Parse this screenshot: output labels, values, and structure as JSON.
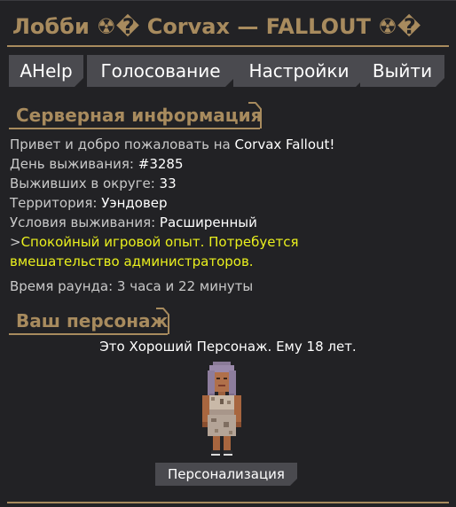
{
  "window": {
    "title": "Лобби  ☢� Corvax — FALLOUT ☢�"
  },
  "nav": {
    "ahelp": "AHelp",
    "vote": "Голосование",
    "settings": "Настройки",
    "exit": "Выйти"
  },
  "server_info": {
    "header": "Серверная информация",
    "greeting_prefix": "Привет и добро пожаловать на ",
    "greeting_value": "Corvax Fallout!",
    "day_label": "День выживания: ",
    "day_value": "#3285",
    "survivors_label": "Выживших в округе: ",
    "survivors_value": "33",
    "territory_label": "Территория: ",
    "territory_value": "Уэндовер",
    "conditions_label": "Условия выживания: ",
    "conditions_value": "Расширенный",
    "note_prefix": ">",
    "note_line1": "Спокойный игровой опыт. Потребуется",
    "note_line2": "вмешательство администраторов.",
    "round_time": "Время раунда: 3 часа и 22 минуты"
  },
  "character": {
    "header": "Ваш персонаж",
    "description": "Это Хороший Персонаж. Ему 18 лет.",
    "customize_label": "Персонализация"
  },
  "colors": {
    "accent": "#a88b5e",
    "background": "#222225",
    "button": "#4a4a4f",
    "highlight_yellow": "#eaf01e"
  }
}
